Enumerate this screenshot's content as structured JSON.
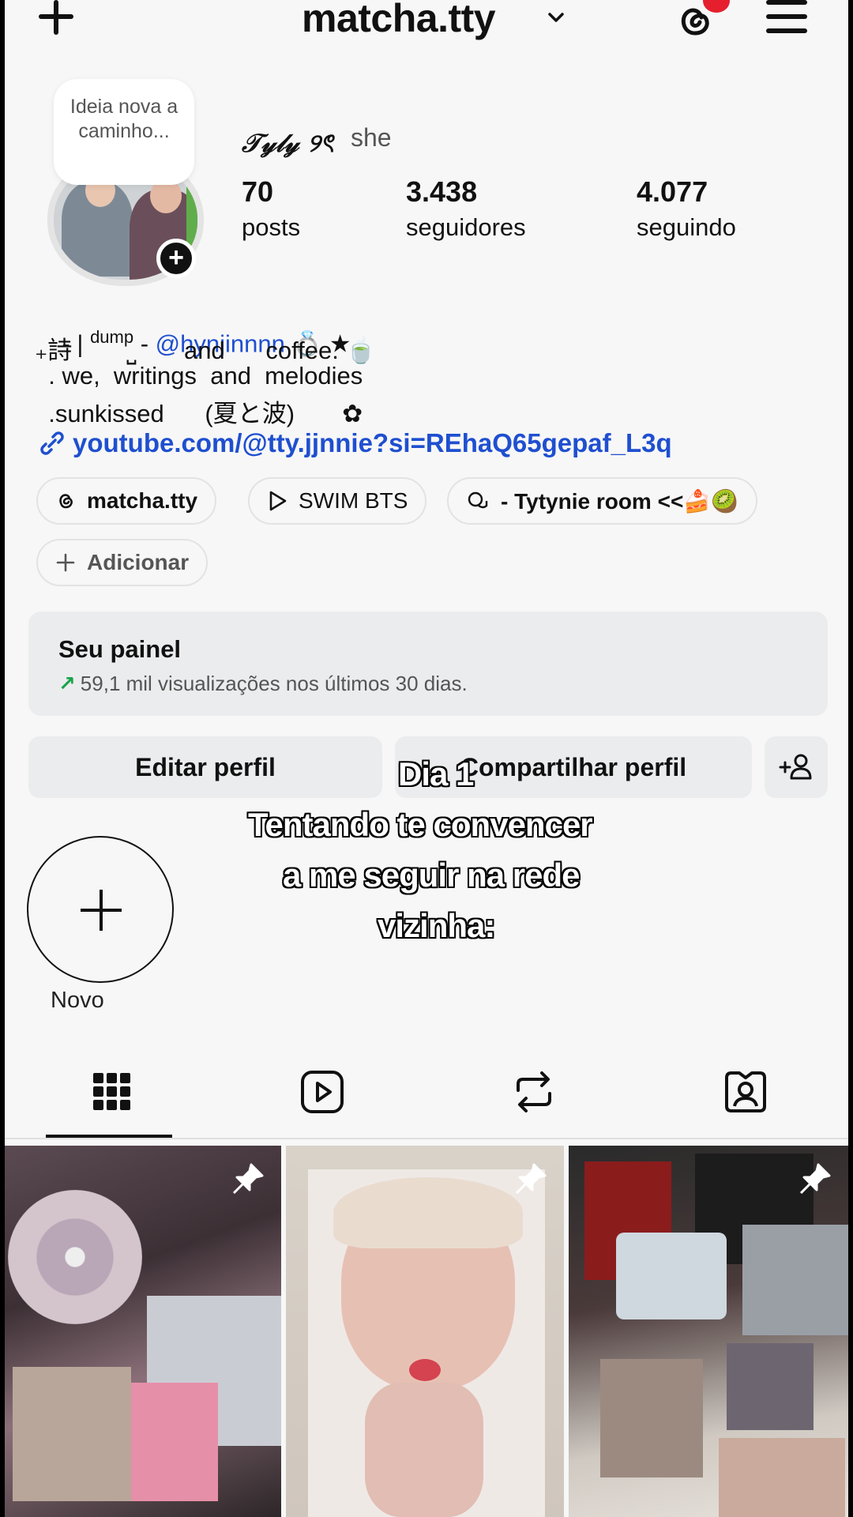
{
  "header": {
    "username": "matcha.tty",
    "icons": [
      "plus-icon",
      "chevron-down-icon",
      "threads-icon",
      "menu-icon"
    ],
    "accent_notification": "#e51f2e"
  },
  "note": {
    "text": "Ideia nova a caminho..."
  },
  "profile": {
    "display_name": "𝒯𝓎𝓁𝓎 ୨ৎ",
    "pronouns": "she"
  },
  "stats": [
    {
      "value": "70",
      "label": "posts"
    },
    {
      "value": "3.438",
      "label": "seguidores"
    },
    {
      "value": "4.077",
      "label": "seguindo"
    }
  ],
  "bio": {
    "line1_prefix": "- | ",
    "line1_sup": "dump",
    "line1_sep": " - ",
    "line1_mention": "@hynjinnnn",
    "line1_suffix": " 💍 ★",
    "line2": "₊詩        ⎵       and      coffee. 🍵",
    "line3": "  . we,  writings  and  melodies",
    "line4": "  .sunkissed      (夏と波)       ✿",
    "link": "youtube.com/@tty.jjnnie?si=REhaQ65gepaf_L3q"
  },
  "chips": [
    {
      "label": "matcha.tty",
      "icon": "threads-icon"
    },
    {
      "label": "SWIM BTS",
      "icon": "play-icon"
    },
    {
      "label": "- Tytynie room <<🍰🥝",
      "icon": "chat-icon"
    },
    {
      "label": "Adicionar",
      "icon": "plus-icon"
    }
  ],
  "panel": {
    "title": "Seu painel",
    "subtitle": "59,1 mil visualizações nos últimos 30 dias.",
    "arrow": "↗",
    "accent": "#1aa34a"
  },
  "buttons": {
    "edit": "Editar perfil",
    "share": "Compartilhar perfil"
  },
  "overlay": {
    "line1": "Dia 1",
    "line2": "Tentando te convencer",
    "line3": "a me seguir na rede",
    "line4": "vizinha:"
  },
  "highlights": {
    "new_label": "Novo"
  },
  "tabs": [
    "grid-icon",
    "reels-icon",
    "reposts-icon",
    "tagged-icon"
  ],
  "grid": {
    "pinned_count": 3
  }
}
